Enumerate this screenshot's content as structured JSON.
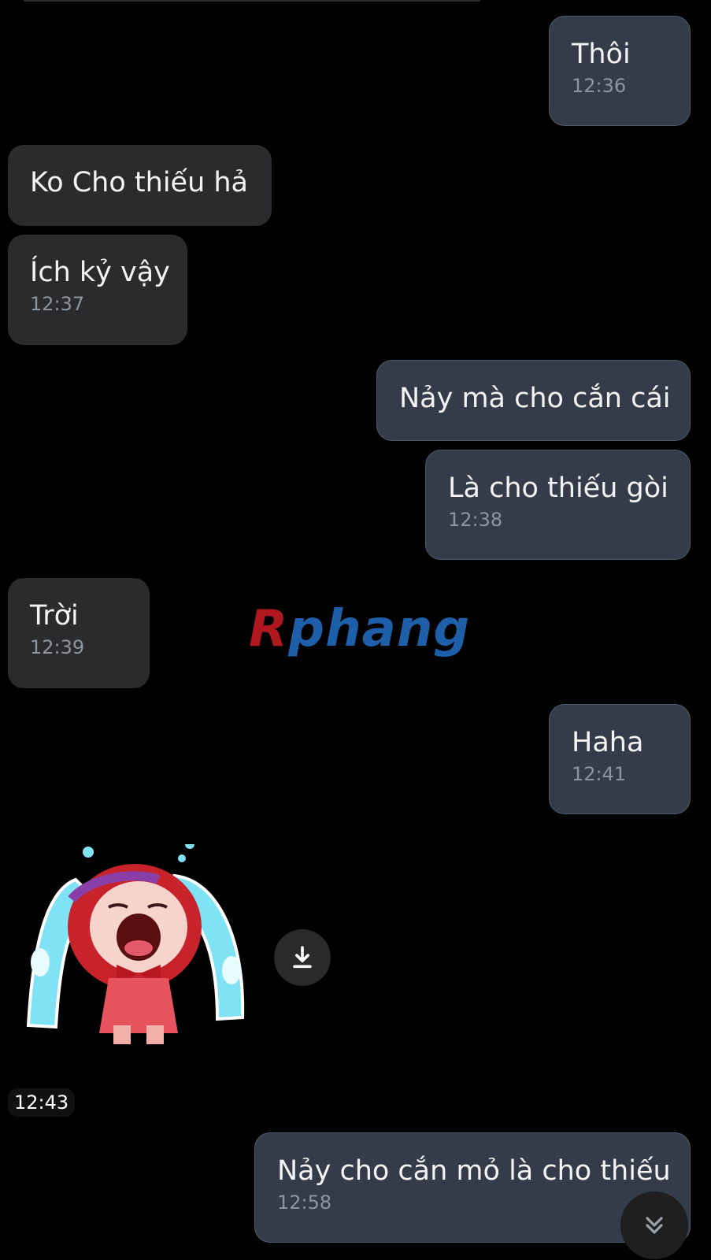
{
  "messages": [
    {
      "id": "m1",
      "direction": "outgoing",
      "text": "Thôi",
      "time": "12:36"
    },
    {
      "id": "m2",
      "direction": "incoming",
      "text": "Ko Cho thiếu hả",
      "time": ""
    },
    {
      "id": "m3",
      "direction": "incoming",
      "text": "Ích kỷ vậy",
      "time": "12:37"
    },
    {
      "id": "m4",
      "direction": "outgoing",
      "text": "Nảy mà cho cắn cái",
      "time": ""
    },
    {
      "id": "m5",
      "direction": "outgoing",
      "text": "Là cho thiếu gòi",
      "time": "12:38"
    },
    {
      "id": "m6",
      "direction": "incoming",
      "text": "Trời",
      "time": "12:39"
    },
    {
      "id": "m7",
      "direction": "outgoing",
      "text": "Haha",
      "time": "12:41"
    },
    {
      "id": "m9",
      "direction": "outgoing",
      "text": "Nảy cho cắn mỏ là cho thiếu",
      "time": "12:58"
    }
  ],
  "sticker": {
    "time": "12:43",
    "icon": "crying-girl-sticker"
  },
  "watermark": {
    "part1": "R",
    "part2": "phang"
  },
  "icons": {
    "download": "download-icon",
    "scroll": "double-chevron-down-icon"
  },
  "colors": {
    "incoming_bubble": "#2b2b2d",
    "outgoing_bubble": "#333c48",
    "background": "#000000"
  }
}
